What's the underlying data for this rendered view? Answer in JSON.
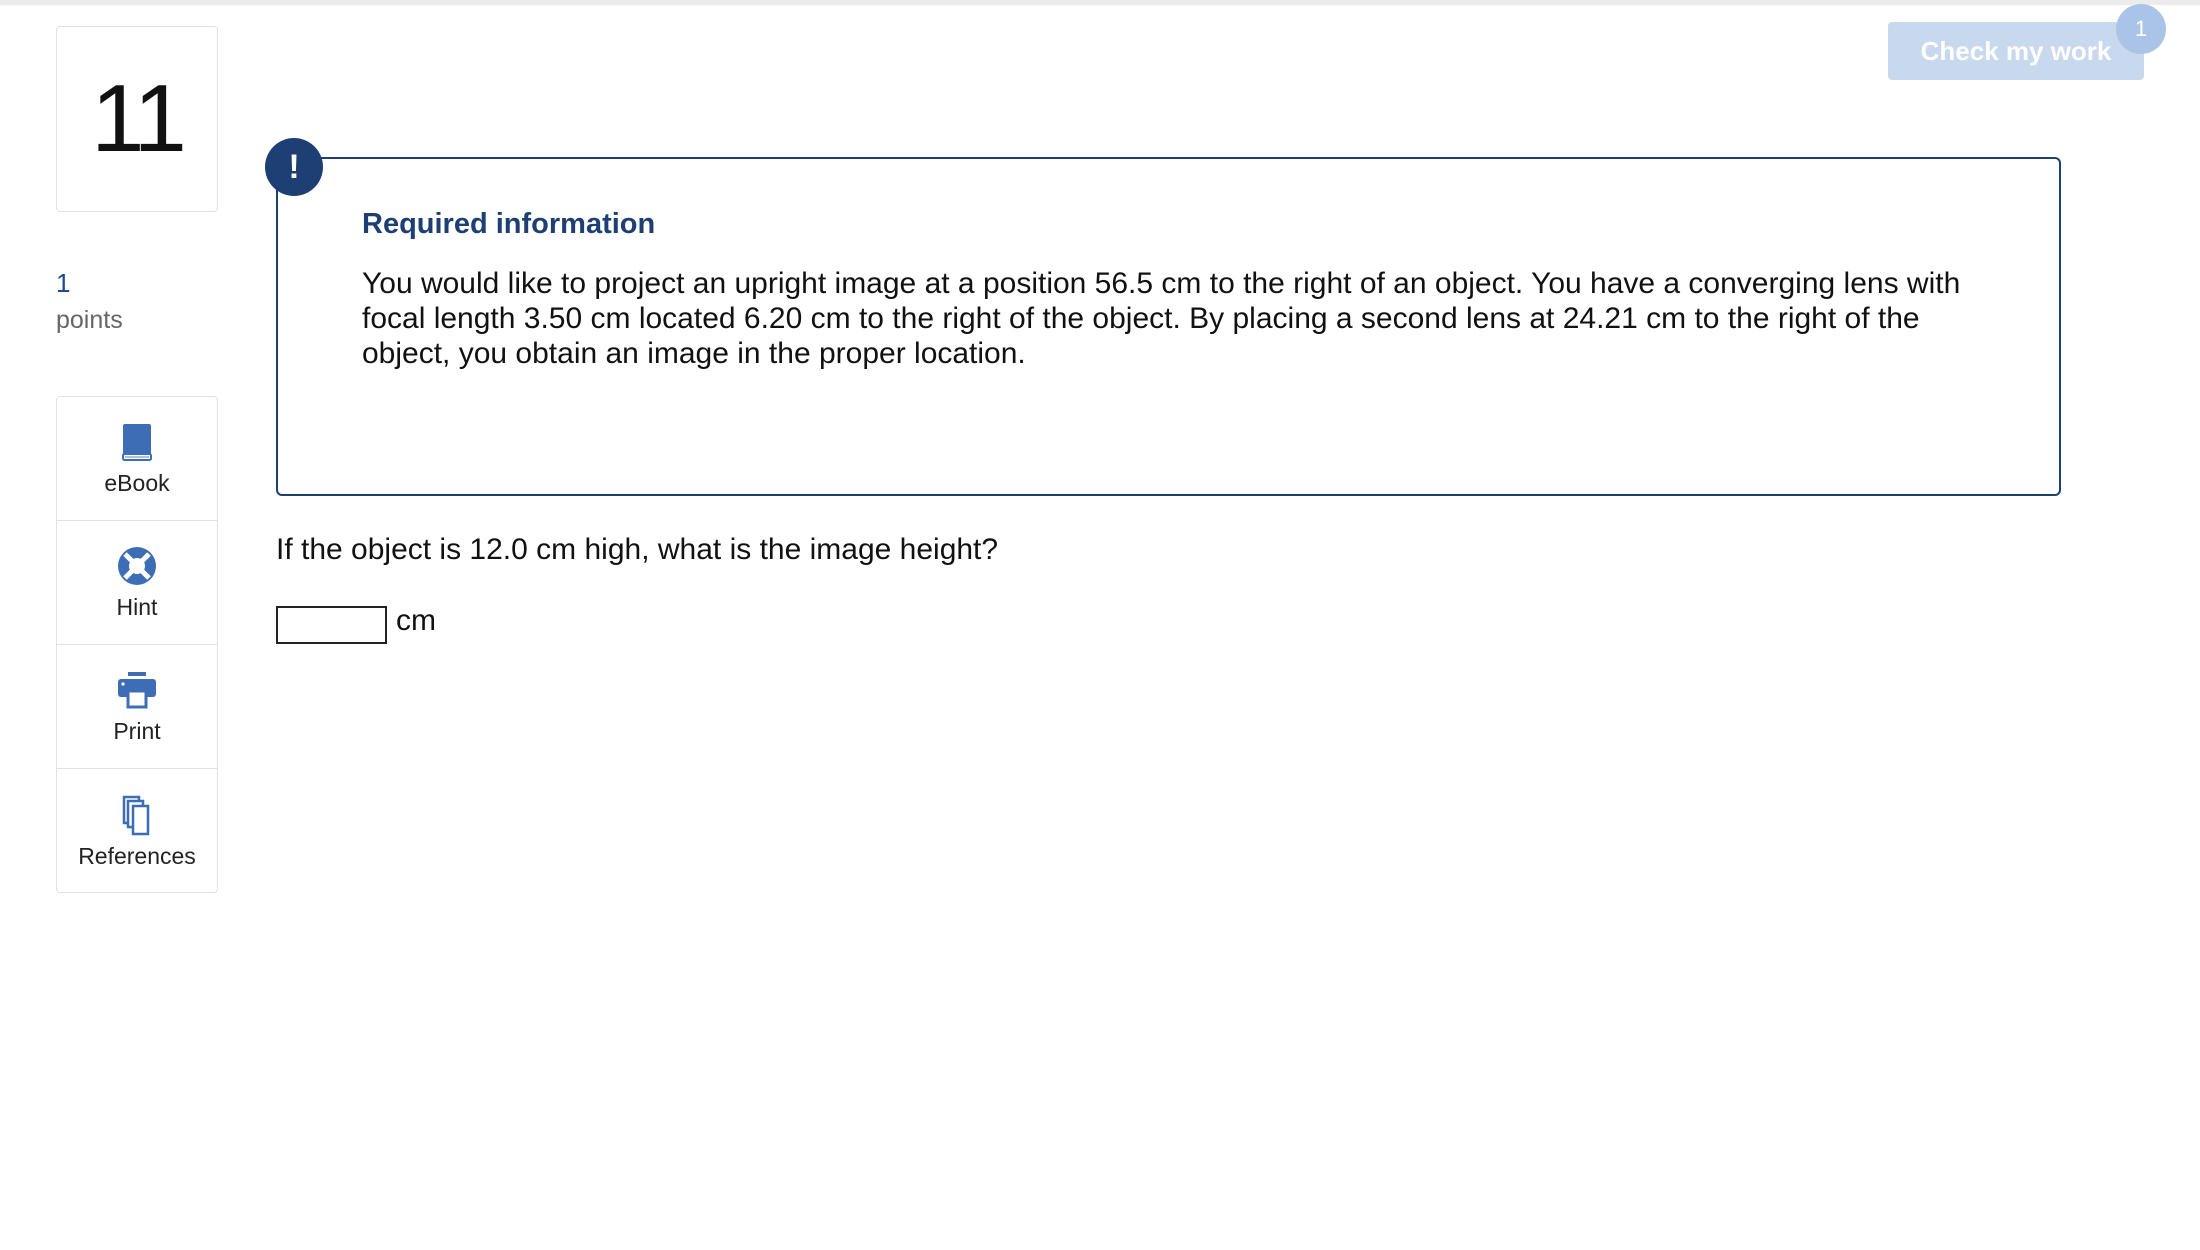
{
  "question": {
    "number": "11",
    "points_value": "1",
    "points_label": "points",
    "prompt": "If the object is 12.0 cm high, what is the image height?",
    "answer_value": "",
    "answer_unit": "cm"
  },
  "tools": [
    {
      "label": "eBook",
      "icon": "book-icon"
    },
    {
      "label": "Hint",
      "icon": "lifebuoy-icon"
    },
    {
      "label": "Print",
      "icon": "printer-icon"
    },
    {
      "label": "References",
      "icon": "copy-documents-icon"
    }
  ],
  "header": {
    "check_label": "Check my work",
    "check_badge": "1"
  },
  "info": {
    "alert_symbol": "!",
    "title": "Required information",
    "body": "You would like to project an upright image at a position 56.5 cm to the right of an object. You have a converging lens with focal length 3.50 cm located 6.20 cm to the right of the object. By placing a second lens at 24.21 cm to the right of the object, you obtain an image in the proper location."
  },
  "colors": {
    "accent": "#1d3f73",
    "icon": "#3d6db5",
    "check_button_disabled": "#c8d9ee"
  }
}
